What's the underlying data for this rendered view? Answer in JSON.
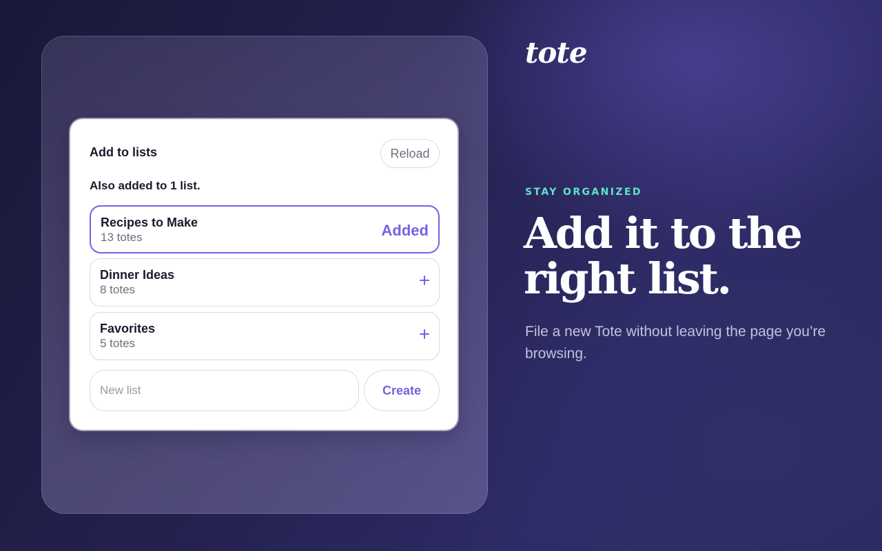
{
  "brand": {
    "logo_text": "tote"
  },
  "marketing": {
    "eyebrow": "STAY ORGANIZED",
    "headline": "Add it to the right list.",
    "subtext": "File a new Tote without leaving the page you’re browsing."
  },
  "popup": {
    "title": "Add to lists",
    "reload_label": "Reload",
    "also_added_text": "Also added to 1 list.",
    "lists": [
      {
        "name": "Recipes to Make",
        "count": "13 totes",
        "status": "Added"
      },
      {
        "name": "Dinner Ideas",
        "count": "8 totes",
        "status": "+"
      },
      {
        "name": "Favorites",
        "count": "5 totes",
        "status": "+"
      }
    ],
    "new_list": {
      "placeholder": "New list",
      "value": ""
    },
    "create_label": "Create"
  },
  "colors": {
    "accent": "#7a5fe0",
    "eyebrow": "#5ee3c8",
    "background": "#24214f",
    "card": "#ffffff"
  },
  "icons": {
    "add_to_list": "plus-icon"
  }
}
